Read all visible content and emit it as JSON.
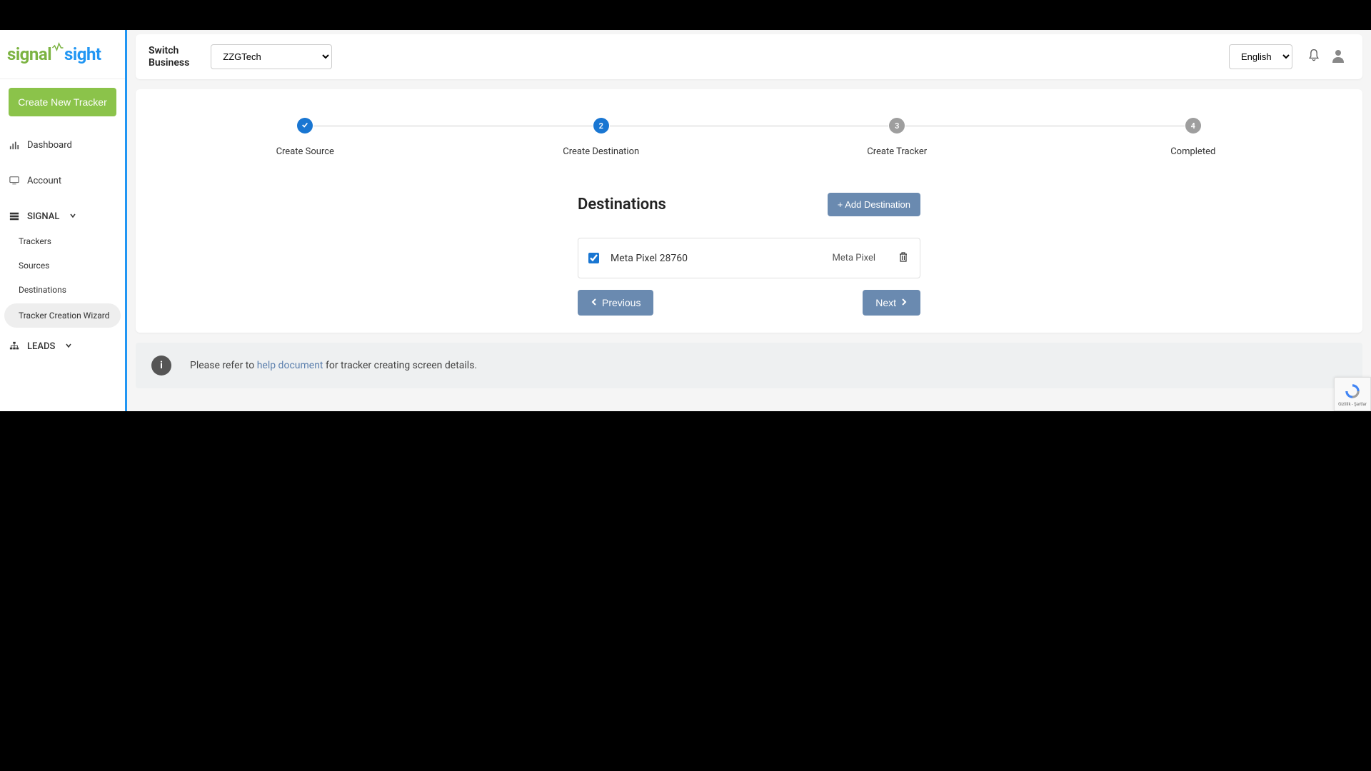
{
  "logo": {
    "part1": "signal",
    "part2": "sight"
  },
  "sidebar": {
    "create_tracker_label": "Create New Tracker",
    "items": {
      "dashboard": "Dashboard",
      "account": "Account",
      "signal": "SIGNAL",
      "trackers": "Trackers",
      "sources": "Sources",
      "destinations": "Destinations",
      "wizard": "Tracker Creation Wizard",
      "leads": "LEADS"
    }
  },
  "topbar": {
    "switch_label_line1": "Switch",
    "switch_label_line2": "Business",
    "business_value": "ZZGTech",
    "language_value": "English"
  },
  "stepper": {
    "steps": [
      {
        "num": "✓",
        "label": "Create Source",
        "state": "done"
      },
      {
        "num": "2",
        "label": "Create Destination",
        "state": "active"
      },
      {
        "num": "3",
        "label": "Create Tracker",
        "state": "pending"
      },
      {
        "num": "4",
        "label": "Completed",
        "state": "pending"
      }
    ]
  },
  "destinations": {
    "title": "Destinations",
    "add_button": "+ Add Destination",
    "rows": [
      {
        "checked": true,
        "name": "Meta Pixel 28760",
        "type": "Meta Pixel"
      }
    ]
  },
  "nav_buttons": {
    "prev": "Previous",
    "next": "Next"
  },
  "info": {
    "pre": "Please refer to ",
    "link": "help document",
    "post": " for tracker creating screen details."
  },
  "recaptcha": {
    "line": "Gizlilik - Şartlar"
  }
}
